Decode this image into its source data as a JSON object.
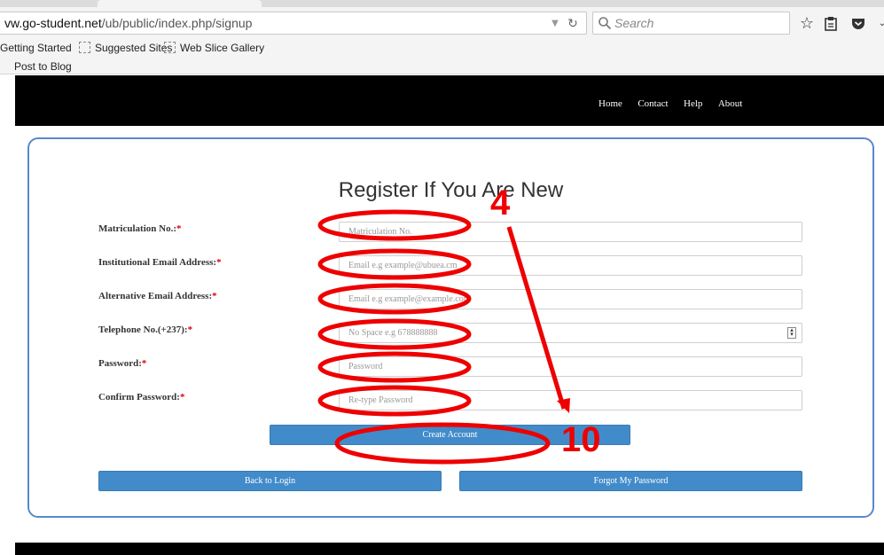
{
  "browser": {
    "url_prefix": "vw.go-student.net",
    "url_path": "/ub/public/index.php/signup",
    "search_placeholder": "Search",
    "toolbar_icons": [
      "star-icon",
      "reading-list-icon",
      "pocket-icon",
      "menu-chevron-icon"
    ],
    "bookmarks": [
      "Getting Started",
      "Suggested Sites",
      "Web Slice Gallery",
      "Post to Blog"
    ]
  },
  "header": {
    "nav": [
      "Home",
      "Contact",
      "Help",
      "About"
    ]
  },
  "form": {
    "title": "Register If You Are New",
    "fields": [
      {
        "label": "Matriculation No.:",
        "required_mark": "*",
        "placeholder": "Matriculation No."
      },
      {
        "label": "Institutional Email Address:",
        "required_mark": "*",
        "placeholder": "Email e.g example@ubuea.cm"
      },
      {
        "label": "Alternative Email Address:",
        "required_mark": "*",
        "placeholder": "Email e.g example@example.com"
      },
      {
        "label": "Telephone No.(+237):",
        "required_mark": "*",
        "placeholder": "No Space e.g 678888888"
      },
      {
        "label": "Password:",
        "required_mark": "*",
        "placeholder": "Password"
      },
      {
        "label": "Confirm Password:",
        "required_mark": "*",
        "placeholder": "Re-type Password"
      }
    ],
    "create_button": "Create Account",
    "back_button": "Back to Login",
    "forgot_button": "Forgot My Password",
    "button_color": "#428bca"
  },
  "annotation": {
    "color": "#ee0000",
    "count_fields": "4",
    "count_total": "10"
  }
}
